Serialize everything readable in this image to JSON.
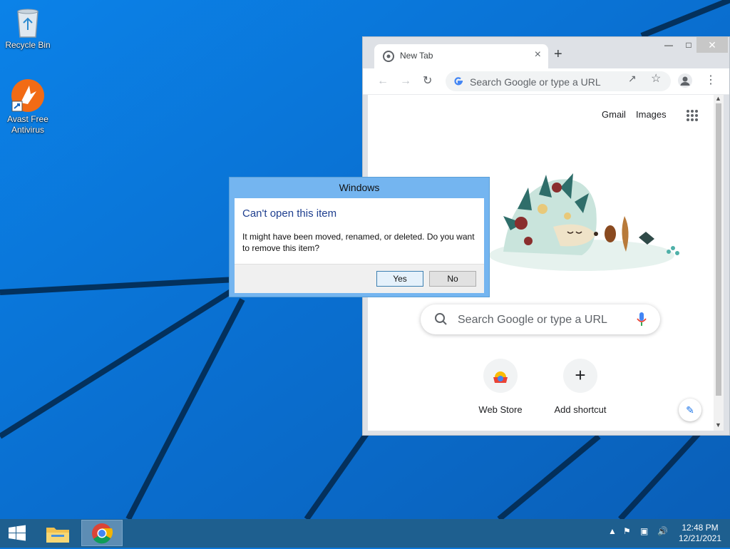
{
  "desktop": {
    "icons": [
      {
        "label": "Recycle Bin"
      },
      {
        "label": "Avast Free Antivirus"
      }
    ]
  },
  "chrome": {
    "tab_title": "New Tab",
    "omnibox_placeholder": "Search Google or type a URL",
    "links": {
      "gmail": "Gmail",
      "images": "Images"
    },
    "search_placeholder": "Search Google or type a URL",
    "shortcuts": [
      {
        "label": "Web Store"
      },
      {
        "label": "Add shortcut"
      }
    ]
  },
  "dialog": {
    "title": "Windows",
    "heading": "Can't open this item",
    "message": "It might have been moved, renamed, or deleted. Do you want to remove this item?",
    "yes_label": "Yes",
    "no_label": "No"
  },
  "taskbar": {
    "time": "12:48 PM",
    "date": "12/21/2021"
  },
  "colors": {
    "wallpaper": "#0a76d8",
    "taskbar": "#1e5f8f",
    "dialog_frame": "#74b5f0",
    "dialog_heading": "#1f3f8f"
  }
}
